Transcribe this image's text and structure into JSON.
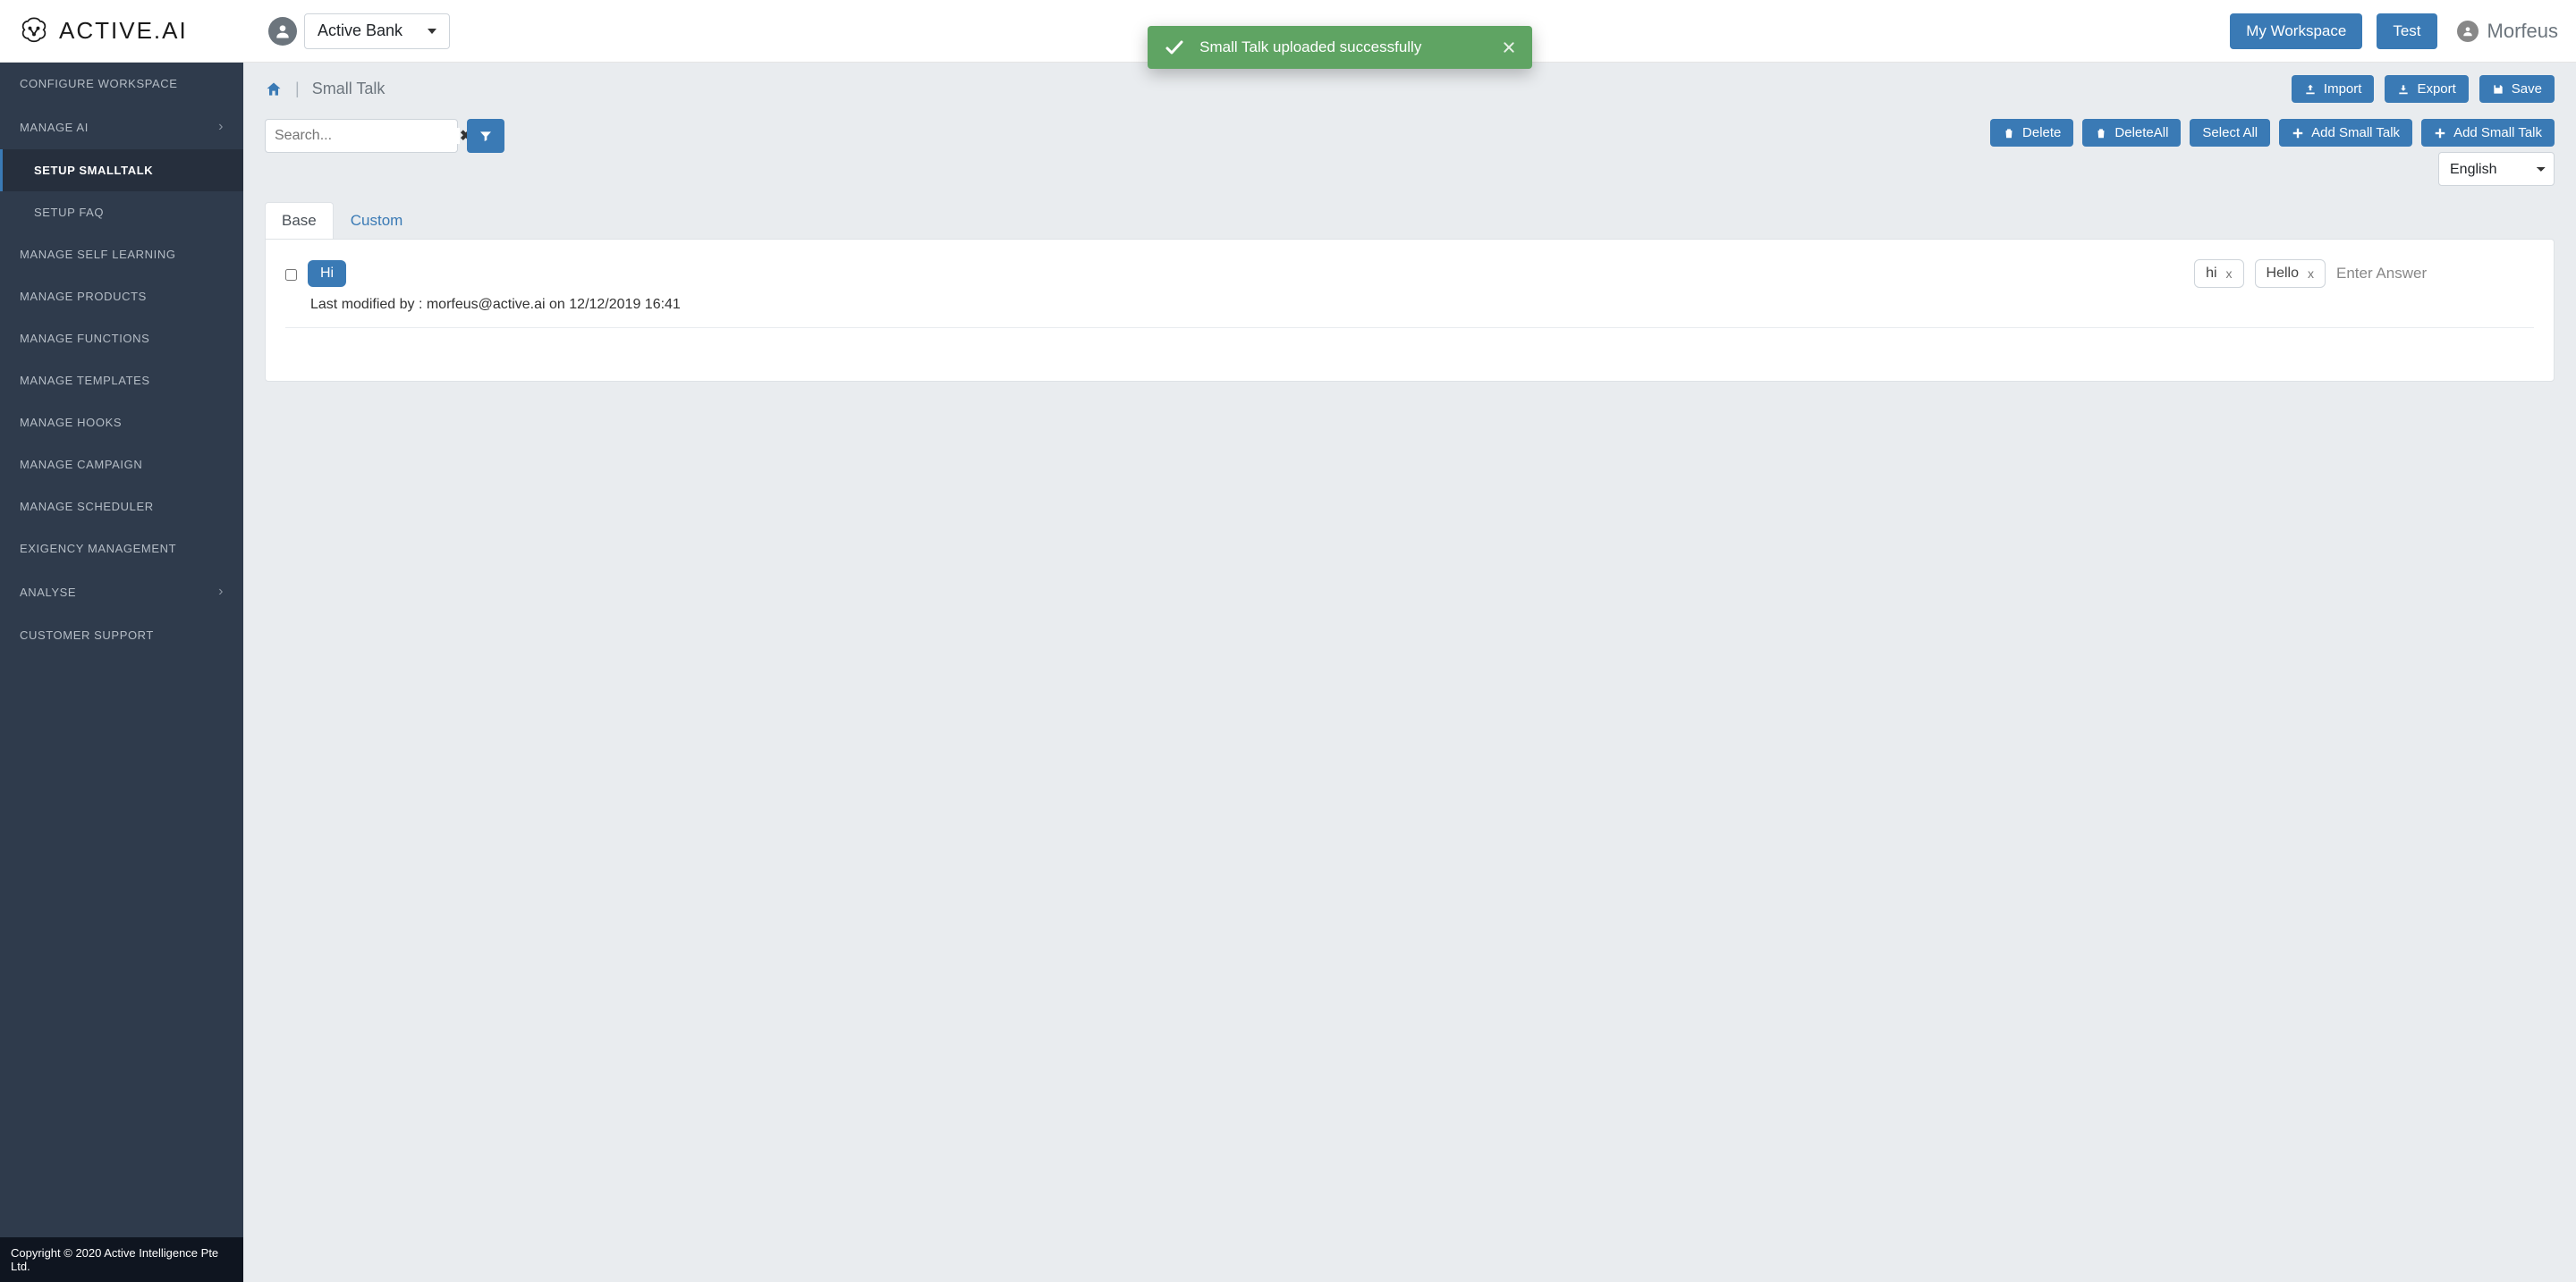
{
  "brand": {
    "name": "ACTIVE.AI"
  },
  "workspace": {
    "selected": "Active Bank"
  },
  "toast": {
    "message": "Small Talk uploaded successfully"
  },
  "top_actions": {
    "my_workspace": "My Workspace",
    "test": "Test"
  },
  "user": {
    "name": "Morfeus"
  },
  "sidebar": {
    "items": [
      {
        "label": "CONFIGURE WORKSPACE",
        "has_children": false
      },
      {
        "label": "MANAGE AI",
        "has_children": true
      },
      {
        "label": "SETUP SMALLTALK",
        "sub": true,
        "active": true
      },
      {
        "label": "SETUP FAQ",
        "sub": true
      },
      {
        "label": "MANAGE SELF LEARNING"
      },
      {
        "label": "MANAGE PRODUCTS"
      },
      {
        "label": "MANAGE FUNCTIONS"
      },
      {
        "label": "MANAGE TEMPLATES"
      },
      {
        "label": "MANAGE HOOKS"
      },
      {
        "label": "MANAGE CAMPAIGN"
      },
      {
        "label": "MANAGE SCHEDULER"
      },
      {
        "label": "EXIGENCY MANAGEMENT"
      },
      {
        "label": "ANALYSE",
        "has_children": true
      },
      {
        "label": "CUSTOMER SUPPORT"
      }
    ],
    "footer": "Copyright © 2020 Active Intelligence Pte Ltd."
  },
  "breadcrumb": {
    "current": "Small Talk"
  },
  "page_actions": {
    "import": "Import",
    "export": "Export",
    "save": "Save"
  },
  "search": {
    "placeholder": "Search...",
    "value": ""
  },
  "toolbar": {
    "delete": "Delete",
    "delete_all": "DeleteAll",
    "select_all": "Select All",
    "add_small_talk_1": "Add Small Talk",
    "add_small_talk_2": "Add Small Talk",
    "language": "English"
  },
  "tabs": {
    "base": "Base",
    "custom": "Custom"
  },
  "entry": {
    "primary_tag": "Hi",
    "chips": [
      {
        "text": "hi"
      },
      {
        "text": "Hello"
      }
    ],
    "answer_placeholder": "Enter Answer",
    "last_modified": "Last modified by : morfeus@active.ai on 12/12/2019 16:41"
  }
}
